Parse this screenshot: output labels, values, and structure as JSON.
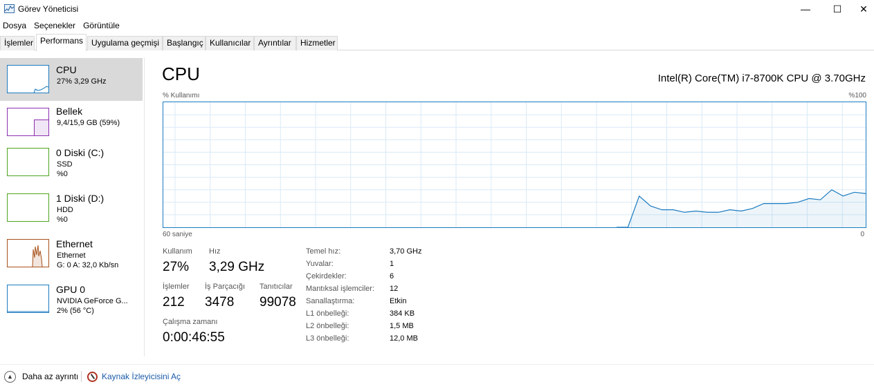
{
  "window": {
    "title": "Görev Yöneticisi",
    "minimize": "—",
    "maximize": "☐",
    "close": "✕"
  },
  "menu": [
    "Dosya",
    "Seçenekler",
    "Görüntüle"
  ],
  "tabs": [
    "İşlemler",
    "Performans",
    "Uygulama geçmişi",
    "Başlangıç",
    "Kullanıcılar",
    "Ayrıntılar",
    "Hizmetler"
  ],
  "active_tab": "Performans",
  "sidebar": {
    "items": [
      {
        "title": "CPU",
        "lines": [
          "27% 3,29 GHz"
        ],
        "color": "#1a7abf",
        "selected": true
      },
      {
        "title": "Bellek",
        "lines": [
          "9,4/15,9 GB (59%)"
        ],
        "color": "#8b2fb0",
        "fill": 0.59
      },
      {
        "title": "0 Diski (C:)",
        "lines": [
          "SSD",
          "%0"
        ],
        "color": "#4da41e"
      },
      {
        "title": "1 Diski (D:)",
        "lines": [
          "HDD",
          "%0"
        ],
        "color": "#4da41e"
      },
      {
        "title": "Ethernet",
        "lines": [
          "Ethernet",
          "G: 0 A: 32,0 Kb/sn"
        ],
        "color": "#a7501a"
      },
      {
        "title": "GPU 0",
        "lines": [
          "NVIDIA GeForce G...",
          "2% (56 °C)"
        ],
        "color": "#1a7abf"
      }
    ]
  },
  "main": {
    "title": "CPU",
    "model": "Intel(R) Core(TM) i7-8700K CPU @ 3.70GHz",
    "graph_top_left": "% Kullanımı",
    "graph_top_right": "%100",
    "graph_bottom_left": "60 saniye",
    "graph_bottom_right": "0",
    "graph_color": "#1a7abf",
    "usage_history_percent": [
      0,
      0,
      25,
      17,
      14,
      14,
      12,
      13,
      12,
      12,
      14,
      13,
      15,
      19,
      19,
      19,
      20,
      23,
      22,
      30,
      25,
      28,
      27
    ],
    "stats": {
      "usage_label": "Kullanım",
      "usage_value": "27%",
      "speed_label": "Hız",
      "speed_value": "3,29 GHz",
      "processes_label": "İşlemler",
      "processes_value": "212",
      "threads_label": "İş Parçacığı",
      "threads_value": "3478",
      "handles_label": "Tanıtıcılar",
      "handles_value": "99078",
      "uptime_label": "Çalışma zamanı",
      "uptime_value": "0:00:46:55"
    },
    "details": [
      {
        "label": "Temel hız:",
        "value": "3,70 GHz"
      },
      {
        "label": "Yuvalar:",
        "value": "1"
      },
      {
        "label": "Çekirdekler:",
        "value": "6"
      },
      {
        "label": "Mantıksal işlemciler:",
        "value": "12"
      },
      {
        "label": "Sanallaştırma:",
        "value": "Etkin"
      },
      {
        "label": "L1 önbelleği:",
        "value": "384 KB"
      },
      {
        "label": "L2 önbelleği:",
        "value": "1,5 MB"
      },
      {
        "label": "L3 önbelleği:",
        "value": "12,0 MB"
      }
    ]
  },
  "footer": {
    "fewer_details": "Daha az ayrıntı",
    "fewer_icon": "chevron-up-icon",
    "resmon": "Kaynak İzleyicisini Aç"
  }
}
